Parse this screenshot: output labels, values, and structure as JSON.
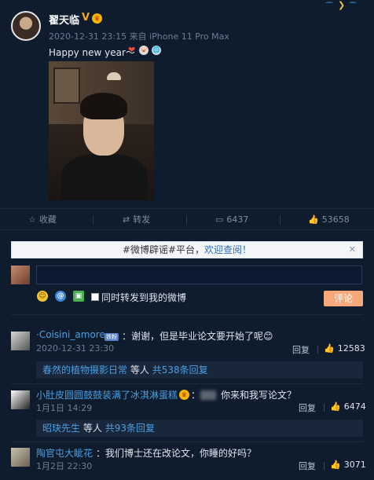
{
  "post": {
    "username": "翟天临",
    "v_mark": "V",
    "vip_mark": "♛",
    "meta": "2020-12-31 23:15 来自 iPhone 11 Pro Max",
    "text": "Happy new year～",
    "emoji_heart": "❤",
    "emoji_pig": "🐷",
    "emoji_globe": "🌐"
  },
  "actions": {
    "favorite": "收藏",
    "repost": "转发",
    "comment_count": "6437",
    "like_count": "53658"
  },
  "notice": {
    "prefix": "#微博辟谣#平台，",
    "link": "欢迎查阅！",
    "close": "✕"
  },
  "composer": {
    "repost_checkbox_label": "同时转发到我的微博",
    "submit_label": "评论",
    "icons": [
      "smile-icon",
      "at-icon",
      "image-icon"
    ]
  },
  "comments": [
    {
      "user": "·Coisini_amore",
      "badge": "铁粉",
      "text": "：谢谢，但是毕业论文要开始了呢😊",
      "time": "2020-12-31 23:30",
      "reply": "回复",
      "likes": "12583",
      "sub": {
        "replier": "春然的植物摄影日常",
        "middle": "等人",
        "count": "共538条回复"
      }
    },
    {
      "user": "小肚皮圆圆鼓鼓装满了冰淇淋蛋糕",
      "badge": "♛",
      "text_pre": "：",
      "text": "你来和我写论文？",
      "time": "1月1日 14:29",
      "reply": "回复",
      "likes": "6474",
      "sub": {
        "replier": "昭玦先生",
        "middle": "等人",
        "count": "共93条回复"
      }
    },
    {
      "user": "陶官屯大眦花",
      "text": "：我们博士还在改论文，你睡的好吗？",
      "time": "1月2日 22:30",
      "reply": "回复",
      "likes": "3071"
    }
  ],
  "colors": {
    "background": "#0f1c2e",
    "link": "#4b9fe0",
    "accent_button": "#f7a97d"
  }
}
